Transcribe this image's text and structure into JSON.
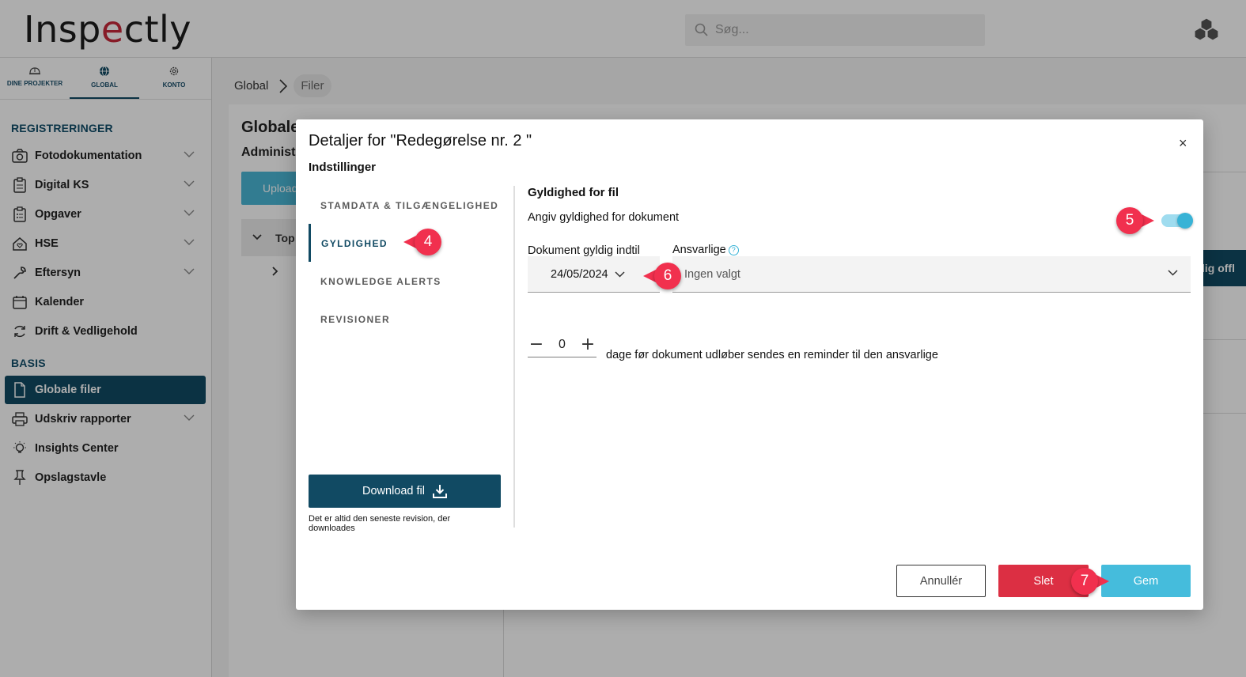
{
  "app": {
    "logo_pre": "Insp",
    "logo_accent": "e",
    "logo_post": "ctly",
    "search_placeholder": "Søg..."
  },
  "sidebar": {
    "tabs": [
      {
        "label": "DINE PROJEKTER",
        "icon": "hardhat-icon"
      },
      {
        "label": "GLOBAL",
        "icon": "globe-icon"
      },
      {
        "label": "KONTO",
        "icon": "gear-icon"
      }
    ],
    "section1": "REGISTRERINGER",
    "items1": [
      {
        "label": "Fotodokumentation",
        "icon": "camera-icon"
      },
      {
        "label": "Digital KS",
        "icon": "clipboard-icon"
      },
      {
        "label": "Opgaver",
        "icon": "clipboard-list-icon"
      },
      {
        "label": "HSE",
        "icon": "house-heart-icon"
      },
      {
        "label": "Eftersyn",
        "icon": "wrench-icon"
      },
      {
        "label": "Kalender",
        "icon": "calendar-icon"
      },
      {
        "label": "Drift & Vedligehold",
        "icon": "refresh-icon"
      }
    ],
    "section2": "BASIS",
    "items2": [
      {
        "label": "Globale filer",
        "icon": "file-icon"
      },
      {
        "label": "Udskriv rapporter",
        "icon": "printer-icon"
      },
      {
        "label": "Insights Center",
        "icon": "lightbulb-icon"
      },
      {
        "label": "Opslagstavle",
        "icon": "pin-icon"
      }
    ]
  },
  "breadcrumb": {
    "root": "Global",
    "current": "Filer"
  },
  "background": {
    "title": "Globale",
    "subtitle": "Administr",
    "upload": "Upload",
    "tree_row": "Top",
    "right_button": "lig offl"
  },
  "modal": {
    "title": "Detaljer for \"Redegørelse nr. 2 \"",
    "close": "×",
    "subtitle": "Indstillinger",
    "nav": [
      "STAMDATA & TILGÆNGELIGHED",
      "GYLDIGHED",
      "KNOWLEDGE ALERTS",
      "REVISIONER"
    ],
    "download_label": "Download fil",
    "download_note": "Det er altid den seneste revision, der downloades",
    "section_title": "Gyldighed for fil",
    "toggle_label": "Angiv gyldighed for dokument",
    "toggle_on": true,
    "date_label": "Dokument gyldig indtil",
    "date_value": "24/05/2024",
    "responsible_label": "Ansvarlige",
    "responsible_help": "?",
    "responsible_value": "Ingen valgt",
    "stepper_value": "0",
    "stepper_minus": "−",
    "stepper_plus": "+",
    "reminder_text": "dage før dokument udløber sendes en reminder til den ansvarlige",
    "cancel": "Annullér",
    "delete": "Slet",
    "save": "Gem"
  },
  "callouts": [
    "4",
    "5",
    "6",
    "7"
  ],
  "colors": {
    "primary": "#114a63",
    "accent": "#45bcdc",
    "danger": "#dc2f43",
    "callout": "#f1304e"
  }
}
